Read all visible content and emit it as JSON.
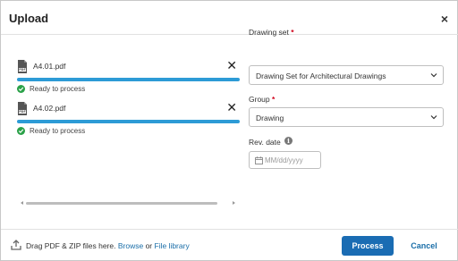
{
  "dialog": {
    "title": "Upload",
    "close_glyph": "×"
  },
  "files": [
    {
      "name": "A4.01.pdf",
      "status": "Ready to process",
      "progress": 1.0,
      "icon": "pdf-file-icon"
    },
    {
      "name": "A4.02.pdf",
      "status": "Ready to process",
      "progress": 1.0,
      "icon": "pdf-file-icon"
    }
  ],
  "form": {
    "drawing_set": {
      "label": "Drawing set",
      "required_mark": "*",
      "value": "Drawing Set for Architectural Drawings"
    },
    "group": {
      "label": "Group",
      "required_mark": "*",
      "value": "Drawing"
    },
    "rev_date": {
      "label": "Rev. date",
      "placeholder": "MM/dd/yyyy",
      "info_glyph": "i"
    }
  },
  "footer": {
    "drop_text": "Drag PDF & ZIP files here.",
    "browse_label": "Browse",
    "or_text": "or",
    "library_label": "File library",
    "process_label": "Process",
    "cancel_label": "Cancel"
  },
  "colors": {
    "accent": "#1a6cb3",
    "progress": "#2d9bd6",
    "success": "#2aa148",
    "required": "#d0021b"
  }
}
